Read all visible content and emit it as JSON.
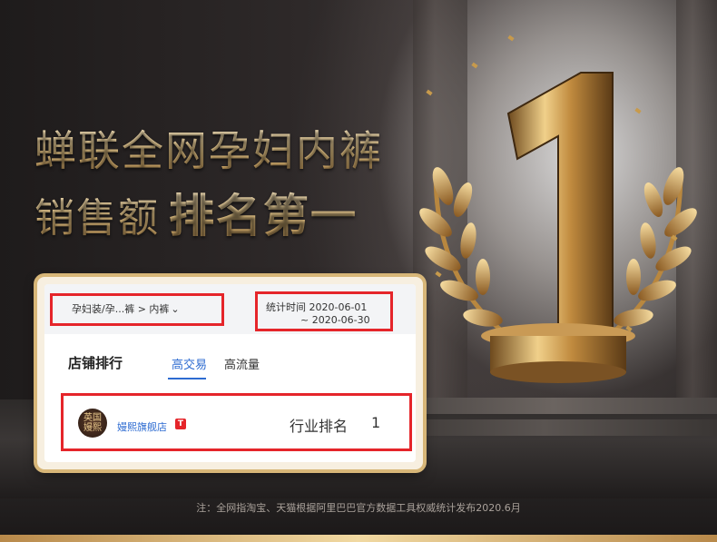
{
  "headline": {
    "line1": "蝉联全网孕妇内裤",
    "line2_prefix": "销售额",
    "line2_bold": "排名第一"
  },
  "card": {
    "breadcrumb": "孕妇装/孕...裤 > 内裤",
    "date_label": "统计时间 2020-06-01",
    "date_end": "~ 2020-06-30",
    "section_title": "店铺排行",
    "tabs": [
      {
        "label": "高交易",
        "active": true
      },
      {
        "label": "高流量",
        "active": false
      }
    ],
    "row": {
      "avatar_text": "英国嫚熙",
      "shop_name": "嫚熙旗舰店",
      "tmall_badge": "T",
      "rank_label": "行业排名",
      "rank_value": "1"
    }
  },
  "footer_note": "注：全网指淘宝、天猫根据阿里巴巴官方数据工具权威统计发布2020.6月",
  "colors": {
    "gold": "#e8c788",
    "highlight_red": "#e5252a",
    "link_blue": "#2d6bd1"
  },
  "icons": [
    "trophy-number-one",
    "laurel-wreath",
    "chevron-down-icon",
    "tmall-badge-icon"
  ]
}
